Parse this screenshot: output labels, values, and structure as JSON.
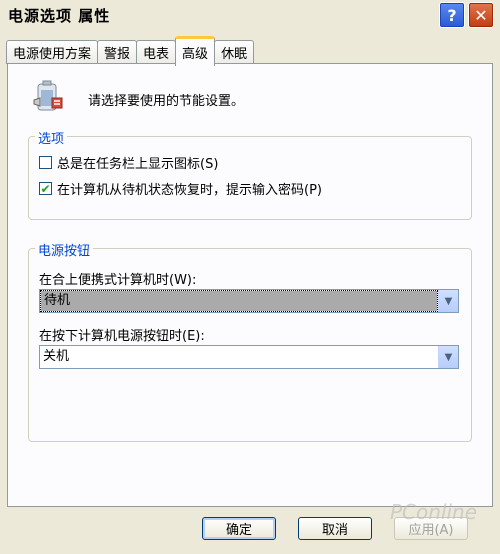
{
  "window": {
    "title": "电源选项 属性",
    "help_label": "?",
    "close_label": "✕"
  },
  "tabs": [
    {
      "label": "电源使用方案",
      "active": false
    },
    {
      "label": "警报",
      "active": false
    },
    {
      "label": "电表",
      "active": false
    },
    {
      "label": "高级",
      "active": true
    },
    {
      "label": "休眠",
      "active": false
    }
  ],
  "intro": {
    "icon": "power-battery-icon",
    "text": "请选择要使用的节能设置。"
  },
  "options_group": {
    "legend": "选项",
    "show_icon": {
      "label": "总是在任务栏上显示图标(S)",
      "checked": false
    },
    "prompt_password": {
      "label": "在计算机从待机状态恢复时，提示输入密码(P)",
      "checked": true
    }
  },
  "power_buttons_group": {
    "legend": "电源按钮",
    "lid_close": {
      "label": "在合上便携式计算机时(W):",
      "value": "待机"
    },
    "power_button": {
      "label": "在按下计算机电源按钮时(E):",
      "value": "关机"
    }
  },
  "buttons": {
    "ok": "确定",
    "cancel": "取消",
    "apply": "应用(A)"
  },
  "watermark": "PConline"
}
